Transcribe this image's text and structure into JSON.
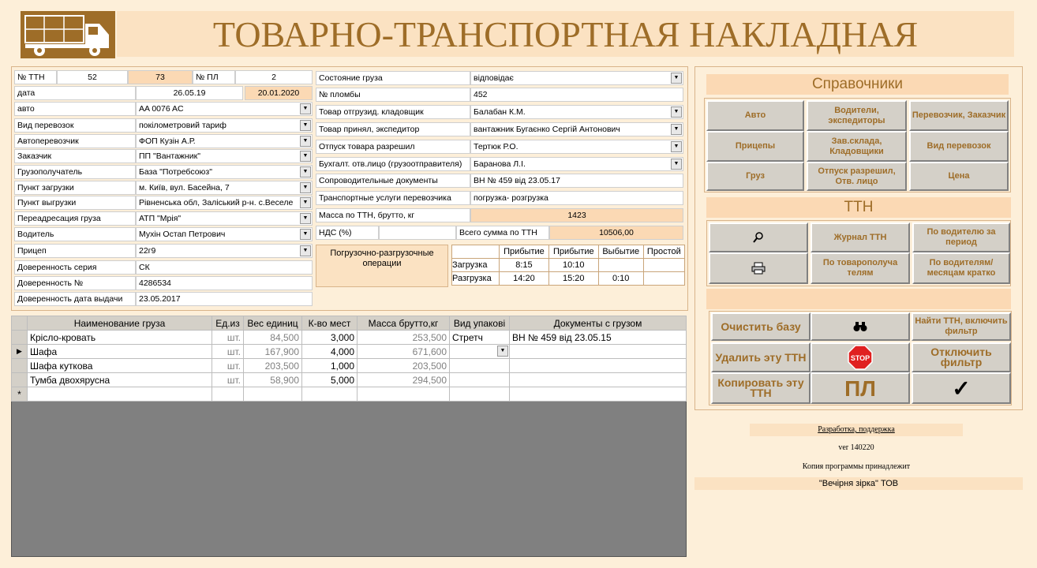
{
  "title": "ТОВАРНО-ТРАНСПОРТНАЯ НАКЛАДНАЯ",
  "left": {
    "ttn_label": "№ ТТН",
    "ttn_no": "52",
    "ttn_no2": "73",
    "pl_label": "№ ПЛ",
    "pl_no": "2",
    "date_label": "дата",
    "date": "26.05.19",
    "date2": "20.01.2020",
    "rows": [
      {
        "label": "авто",
        "value": "AA 0076 AC"
      },
      {
        "label": "Вид перевозок",
        "value": "покілометровий тариф"
      },
      {
        "label": "Автоперевозчик",
        "value": "ФОП Кузін А.Р."
      },
      {
        "label": "Заказчик",
        "value": "ПП \"Вантажник\""
      },
      {
        "label": "Грузополучатель",
        "value": "База \"Потребсоюз\""
      },
      {
        "label": "Пункт загрузки",
        "value": "м. Київ, вул. Басейна, 7"
      },
      {
        "label": "Пункт выгрузки",
        "value": "Рівненська обл, Заліський р-н. с.Веселе"
      },
      {
        "label": "Переадресация груза",
        "value": "АТП \"Мрія\""
      },
      {
        "label": "Водитель",
        "value": "Мухін Остап Петрович"
      },
      {
        "label": "Прицеп",
        "value": "22г9"
      },
      {
        "label": "Доверенность серия",
        "value": "СК"
      },
      {
        "label": "Доверенность №",
        "value": "4286534"
      },
      {
        "label": "Доверенность дата выдачи",
        "value": "23.05.2017"
      }
    ]
  },
  "mid": {
    "rows": [
      {
        "label": "Состояние груза",
        "value": "відповідає"
      },
      {
        "label": "№ пломбы",
        "value": "452"
      },
      {
        "label": "Товар отгрузид. кладовщик",
        "value": "Балабан К.М."
      },
      {
        "label": "Товар принял, экспедитор",
        "value": "вантажник Бугаєнко Сергій Антонович"
      },
      {
        "label": "Отпуск товара разрешил",
        "value": "Тертюк Р.О."
      },
      {
        "label": "Бухгалт. отв.лицо (грузоотправителя)",
        "value": "Баранова Л.І."
      },
      {
        "label": "Сопроводительные документы",
        "value": "ВН № 459 від 23.05.17"
      },
      {
        "label": "Транспортные услуги перевозчика",
        "value": "погрузка- розгрузка"
      }
    ],
    "mass_label": "Масса по ТТН, брутто, кг",
    "mass": "1423",
    "vat_label": "НДС (%)",
    "sum_label": "Всего сумма по ТТН",
    "sum": "10506,00",
    "ops_label": "Погрузочно-разгрузочные операции",
    "ops_headers": [
      "Прибытие",
      "Прибытие",
      "Выбытие",
      "Простой"
    ],
    "ops_rows": [
      [
        "Загрузка",
        "8:15",
        "10:10",
        ""
      ],
      [
        "Разгрузка",
        "14:20",
        "15:20",
        "0:10"
      ]
    ]
  },
  "grid": {
    "headers": [
      "Наименование груза",
      "Ед.из",
      "Вес единиц",
      "К-во мест",
      "Масса брутто,кг",
      "Вид упакові",
      "Документы с грузом"
    ],
    "rows": [
      [
        "Крісло-кровать",
        "шт.",
        "84,500",
        "3,000",
        "253,500",
        "Стретч",
        "ВН № 459 від 23.05.15"
      ],
      [
        "Шафа",
        "шт.",
        "167,900",
        "4,000",
        "671,600",
        "",
        ""
      ],
      [
        "Шафа куткова",
        "шт.",
        "203,500",
        "1,000",
        "203,500",
        "",
        ""
      ],
      [
        "Тумба двохярусна",
        "шт.",
        "58,900",
        "5,000",
        "294,500",
        "",
        ""
      ]
    ],
    "new_row_marker": "*"
  },
  "right": {
    "ref_title": "Справочники",
    "ref_buttons": [
      "Авто",
      "Водители, экспедиторы",
      "Перевозчик, Заказчик",
      "Прицепы",
      "Зав.склада, Кладовщики",
      "Вид перевозок",
      "Груз",
      "Отпуск разрешил, Отв. лицо",
      "Цена"
    ],
    "ttn_title": "ТТН",
    "ttn_buttons": [
      "Журнал ТТН",
      "По водителю за период",
      "По товарополуча телям",
      "По водителям/ месяцам кратко"
    ],
    "action_buttons": [
      "Очистить базу",
      "Найти ТТН, включить фильтр",
      "Удалить эту ТТН",
      "Отключить фильтр",
      "Копировать эту ТТН"
    ],
    "stop_text": "STOP",
    "pl_text": "ПЛ",
    "check_text": "✓",
    "dev_link": "Разработка, поддержка",
    "version": "ver 140220",
    "owner_label": "Копия программы принадлежит",
    "owner": "\"Вечірня зірка\" ТОВ"
  },
  "colors": {
    "accent": "#9e6d28",
    "bg": "#fdefd9",
    "tan": "#fbd9b4",
    "button": "#d4d0c8"
  }
}
